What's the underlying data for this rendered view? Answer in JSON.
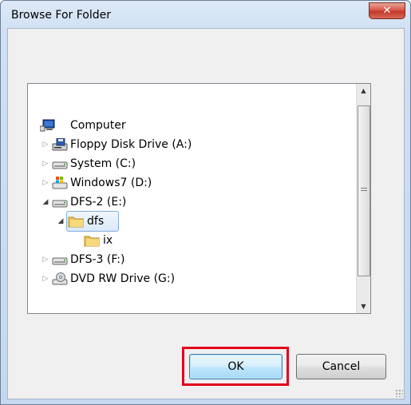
{
  "window": {
    "title": "Browse For Folder",
    "close_glyph": "✕"
  },
  "tree": {
    "items": [
      {
        "label": "Computer",
        "icon": "computer-icon",
        "state": "none"
      },
      {
        "label": "Floppy Disk Drive (A:)",
        "icon": "floppy-drive-icon",
        "state": "collapsed"
      },
      {
        "label": "System (C:)",
        "icon": "hard-drive-icon",
        "state": "collapsed"
      },
      {
        "label": "Windows7 (D:)",
        "icon": "windows-drive-icon",
        "state": "collapsed"
      },
      {
        "label": "DFS-2 (E:)",
        "icon": "hard-drive-icon",
        "state": "expanded"
      },
      {
        "label": "dfs",
        "icon": "folder-icon",
        "state": "expanded",
        "selected": true
      },
      {
        "label": "ix",
        "icon": "folder-icon",
        "state": "none"
      },
      {
        "label": "DFS-3 (F:)",
        "icon": "hard-drive-icon",
        "state": "collapsed"
      },
      {
        "label": "DVD RW Drive (G:)",
        "icon": "dvd-drive-icon",
        "state": "collapsed"
      }
    ]
  },
  "scrollbar": {
    "up_glyph": "▲",
    "down_glyph": "▼"
  },
  "glyphs": {
    "collapsed": "▷",
    "expanded": "◢"
  },
  "buttons": {
    "ok_label": "OK",
    "cancel_label": "Cancel"
  },
  "colors": {
    "highlight_border": "#e3001b",
    "close_button": "#c3372a",
    "selection": "#dbe9fa"
  }
}
